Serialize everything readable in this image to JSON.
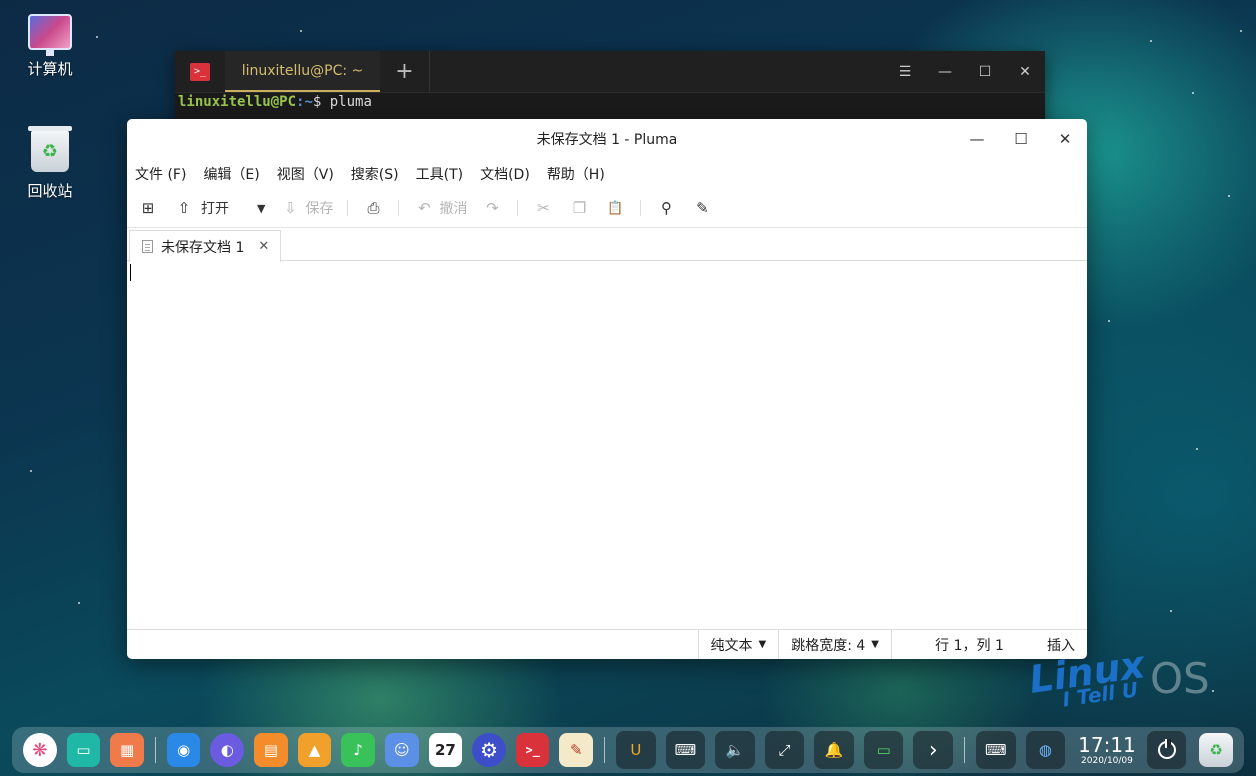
{
  "desktop": {
    "icons": [
      {
        "label": "计算机"
      },
      {
        "label": "回收站"
      }
    ]
  },
  "terminal": {
    "tab_title": "linuxitellu@PC: ~",
    "prompt_user": "linuxitellu@PC",
    "prompt_path": ":~",
    "prompt_symbol": "$ ",
    "command": "pluma",
    "logo_glyph": ">_",
    "add_glyph": "+",
    "menu_glyph": "☰",
    "min_glyph": "—",
    "max_glyph": "☐",
    "close_glyph": "✕"
  },
  "pluma": {
    "window_title": "未保存文档 1 - Pluma",
    "min_glyph": "—",
    "max_glyph": "☐",
    "close_glyph": "✕",
    "menu": [
      "文件 (F)",
      "编辑（E)",
      "视图（V)",
      "搜索(S)",
      "工具(T)",
      "文档(D)",
      "帮助（H)"
    ],
    "toolbar": {
      "new_icon": "⊞",
      "open_icon": "⇧",
      "open_label": "打开",
      "open_dropdown": "▼",
      "save_icon": "⇩",
      "save_label": "保存",
      "print_icon": "⎙",
      "undo_icon": "↶",
      "undo_label": "撤消",
      "redo_icon": "↷",
      "cut_icon": "✂",
      "copy_icon": "❐",
      "paste_icon": "📋",
      "search_icon": "⚲",
      "replace_icon": "✎"
    },
    "tab": {
      "label": "未保存文档 1",
      "close": "✕"
    },
    "status": {
      "syntax": "纯文本",
      "tab_width": "跳格宽度: 4",
      "dropdown": "▼",
      "position": "行 1，列 1",
      "mode": "插入"
    }
  },
  "watermark": {
    "text": "Linux",
    "sub": "I Tell U",
    "os": "OS"
  },
  "dock": {
    "apps": [
      {
        "name": "launcher",
        "glyph": "❋",
        "color": "#ffffff"
      },
      {
        "name": "file-manager",
        "glyph": "▭",
        "color": "#1fb7a6"
      },
      {
        "name": "app-store",
        "glyph": "▦",
        "color": "#f07a4a"
      },
      {
        "name": "store",
        "glyph": "◉",
        "color": "#2a88e6"
      },
      {
        "name": "browser",
        "glyph": "◐",
        "color": "#6a5be0"
      },
      {
        "name": "software-center",
        "glyph": "▤",
        "color": "#f58c2c"
      },
      {
        "name": "photos",
        "glyph": "▲",
        "color": "#f2a02c"
      },
      {
        "name": "music",
        "glyph": "♪",
        "color": "#39c25a"
      },
      {
        "name": "contacts",
        "glyph": "☺",
        "color": "#5c8fe6"
      },
      {
        "name": "calendar",
        "glyph": "27",
        "color": "#ffffff"
      },
      {
        "name": "settings",
        "glyph": "⚙",
        "color": "#3d4fc8"
      },
      {
        "name": "terminal",
        "glyph": ">_",
        "color": "#d9323a"
      },
      {
        "name": "text-editor",
        "glyph": "✎",
        "color": "#f4e9c8"
      }
    ],
    "tray": [
      {
        "name": "input-method",
        "glyph": "U"
      },
      {
        "name": "keyboard",
        "glyph": "⌨"
      },
      {
        "name": "volume",
        "glyph": "🔈"
      },
      {
        "name": "network",
        "glyph": "⤢"
      },
      {
        "name": "notifications",
        "glyph": "🔔"
      },
      {
        "name": "battery",
        "glyph": "▭"
      },
      {
        "name": "expand",
        "glyph": "›"
      },
      {
        "name": "keyboard-2",
        "glyph": "⌨"
      },
      {
        "name": "weather",
        "glyph": "◍"
      }
    ],
    "clock_time": "17:11",
    "clock_date": "2020/10/09",
    "trash_glyph": "♻"
  }
}
